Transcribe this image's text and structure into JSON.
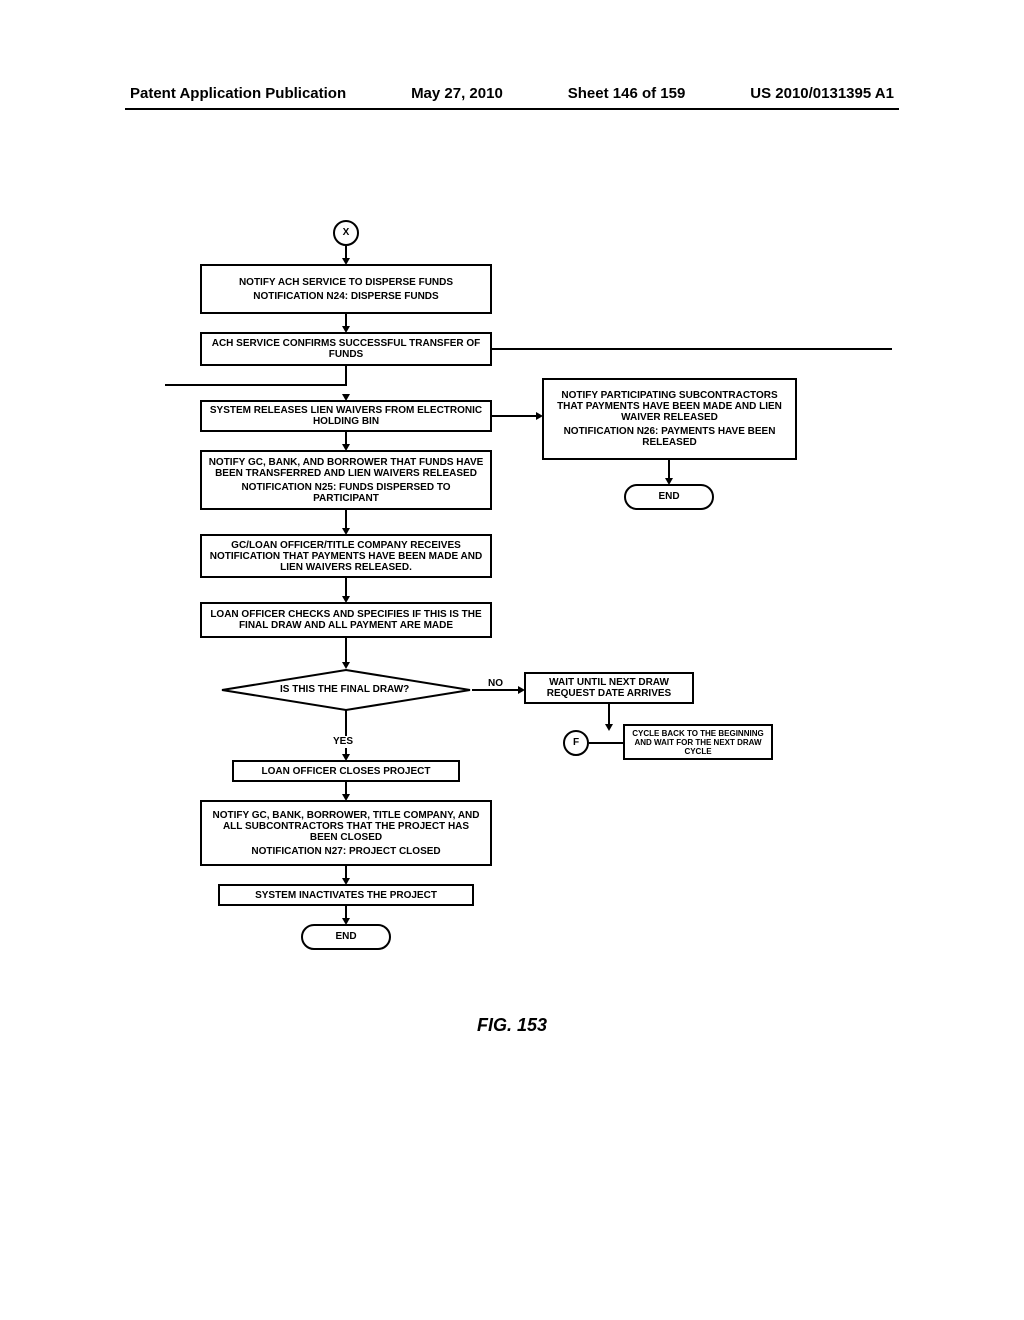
{
  "header": {
    "left": "Patent Application Publication",
    "date": "May 27, 2010",
    "sheet": "Sheet 146 of 159",
    "pubno": "US 2010/0131395 A1"
  },
  "connectors": {
    "x": "X",
    "f": "F"
  },
  "boxes": {
    "box1_line1": "NOTIFY ACH SERVICE TO DISPERSE FUNDS",
    "box1_line2": "NOTIFICATION N24: DISPERSE FUNDS",
    "box2": "ACH SERVICE CONFIRMS SUCCESSFUL TRANSFER OF FUNDS",
    "box3": "SYSTEM RELEASES LIEN WAIVERS FROM ELECTRONIC HOLDING BIN",
    "box4_line1": "NOTIFY GC, BANK, AND BORROWER THAT FUNDS HAVE BEEN TRANSFERRED AND LIEN WAIVERS RELEASED",
    "box4_line2": "NOTIFICATION N25: FUNDS DISPERSED TO PARTICIPANT",
    "box5": "GC/LOAN OFFICER/TITLE COMPANY RECEIVES NOTIFICATION THAT PAYMENTS HAVE BEEN MADE AND LIEN WAIVERS RELEASED.",
    "box6": "LOAN OFFICER CHECKS AND SPECIFIES IF THIS IS THE FINAL DRAW AND ALL PAYMENT ARE MADE",
    "box7_line1": "NOTIFY PARTICIPATING SUBCONTRACTORS THAT PAYMENTS HAVE BEEN MADE AND LIEN WAIVER RELEASED",
    "box7_line2": "NOTIFICATION N26: PAYMENTS HAVE BEEN RELEASED",
    "box8": "LOAN OFFICER CLOSES PROJECT",
    "box9_line1": "NOTIFY GC, BANK, BORROWER, TITLE COMPANY, AND ALL SUBCONTRACTORS THAT THE PROJECT HAS BEEN CLOSED",
    "box9_line2": "NOTIFICATION N27: PROJECT CLOSED",
    "box10": "SYSTEM INACTIVATES THE PROJECT",
    "box11": "WAIT UNTIL NEXT DRAW REQUEST DATE ARRIVES",
    "box12": "CYCLE BACK TO THE BEGINNING AND WAIT FOR THE NEXT DRAW CYCLE"
  },
  "decision": {
    "text": "IS THIS THE FINAL DRAW?",
    "yes": "YES",
    "no": "NO"
  },
  "terminators": {
    "end": "END"
  },
  "figure": "FIG. 153"
}
